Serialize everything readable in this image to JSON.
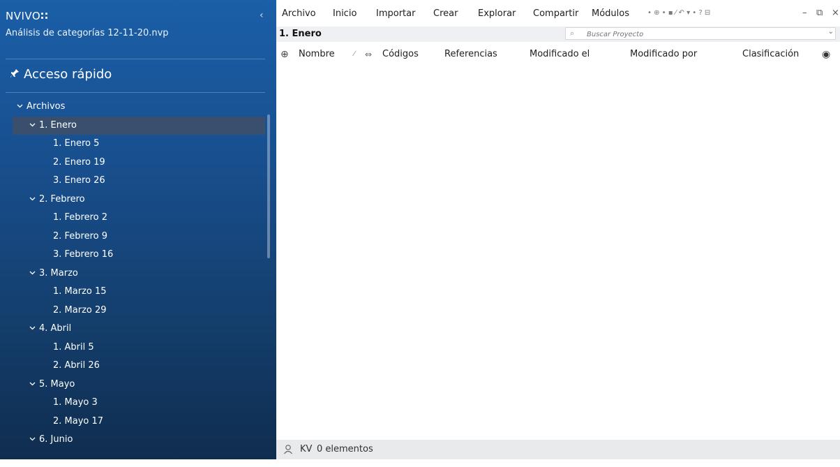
{
  "app": {
    "brand": "NVIVO",
    "brand_mark": "∷",
    "collapse_icon": "‹",
    "project_name": "Análisis de categorías 12-11-20.nvp"
  },
  "sidebar": {
    "quick_access_icon": "pin-icon",
    "quick_access_label": "Acceso rápido",
    "tree": [
      {
        "label": "Archivos",
        "level": 1,
        "expanded": true
      },
      {
        "label": "1. Enero",
        "level": 2,
        "expanded": true,
        "selected": true
      },
      {
        "label": "1. Enero 5",
        "level": 3
      },
      {
        "label": "2. Enero 19",
        "level": 3
      },
      {
        "label": "3. Enero 26",
        "level": 3
      },
      {
        "label": "2. Febrero",
        "level": 2,
        "expanded": true
      },
      {
        "label": "1. Febrero 2",
        "level": 3
      },
      {
        "label": "2. Febrero 9",
        "level": 3
      },
      {
        "label": "3. Febrero 16",
        "level": 3
      },
      {
        "label": "3. Marzo",
        "level": 2,
        "expanded": true
      },
      {
        "label": "1. Marzo 15",
        "level": 3
      },
      {
        "label": "2. Marzo 29",
        "level": 3
      },
      {
        "label": "4. Abril",
        "level": 2,
        "expanded": true
      },
      {
        "label": "1. Abril 5",
        "level": 3
      },
      {
        "label": "2. Abril 26",
        "level": 3
      },
      {
        "label": "5. Mayo",
        "level": 2,
        "expanded": true
      },
      {
        "label": "1. Mayo 3",
        "level": 3
      },
      {
        "label": "2. Mayo 17",
        "level": 3
      },
      {
        "label": "6. Junio",
        "level": 2,
        "expanded": true
      }
    ]
  },
  "menubar": {
    "items": [
      "Archivo",
      "Inicio",
      "Importar",
      "Crear",
      "Explorar",
      "Compartir",
      "Módulos"
    ],
    "toolbar_icons": "• ⊕   • ▪ ⁄ ↶ ▾ •  ?   ⊟",
    "window_controls": [
      "–",
      "⧉",
      "×"
    ]
  },
  "breadcrumb": {
    "title": "1. Enero"
  },
  "search": {
    "placeholder": "Buscar Proyecto",
    "icon": "⌕",
    "dropdown": "⌄"
  },
  "columns": {
    "add_icon": "⊕",
    "name": "Nombre",
    "sort_icon": "⁄",
    "codes_icon": "⇔",
    "codes": "Códigos",
    "references": "Referencias",
    "modified_on": "Modificado el",
    "modified_by": "Modificado por",
    "classification": "Clasificación",
    "color_icon": "◉"
  },
  "status": {
    "user_icon": "person-icon",
    "user": "KV",
    "count": "0 elementos"
  },
  "colors": {
    "sidebar_top": "#1a5fa8",
    "sidebar_bottom": "#0f2d4f",
    "selected_row": "#3a4f6e"
  }
}
